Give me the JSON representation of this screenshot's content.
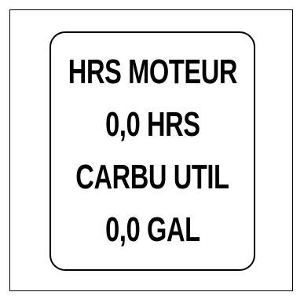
{
  "display": {
    "lines": [
      {
        "label": "HRS MOTEUR"
      },
      {
        "label": "0,0 HRS"
      },
      {
        "label": "CARBU UTIL"
      },
      {
        "label": "0,0 GAL"
      }
    ]
  },
  "colors": {
    "background": "#ffffff",
    "text": "#000000",
    "border": "#000000"
  }
}
